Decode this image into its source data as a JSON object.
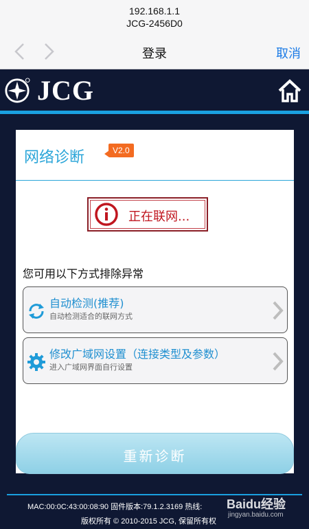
{
  "browser": {
    "url": "192.168.1.1",
    "page_title": "JCG-2456D0",
    "nav_title": "登录",
    "cancel_label": "取消"
  },
  "brand": {
    "name": "JCG"
  },
  "panel": {
    "title": "网络诊断",
    "version": "V2.0",
    "status_text": "正在联网...",
    "hint": "您可用以下方式排除异常",
    "options": [
      {
        "title": "自动检测(推荐)",
        "subtitle": "自动检测适合的联网方式",
        "icon": "refresh-icon"
      },
      {
        "title": "修改广域网设置（连接类型及参数）",
        "subtitle": "进入广域网界面自行设置",
        "icon": "gear-icon"
      }
    ],
    "retry_label": "重新诊断"
  },
  "footer": {
    "line1": "MAC:00:0C:43:00:08:90   固件版本:79.1.2.3169   热线:",
    "line2": "版权所有 © 2010-2015 JCG, 保留所有权"
  },
  "watermark": {
    "logo": "Baidu经验",
    "sub": "jingyan.baidu.com"
  },
  "colors": {
    "header_bg": "#0f1833",
    "accent_blue": "#2aa5d8",
    "status_red": "#c0161f",
    "badge_orange": "#f36b21",
    "link_blue": "#1a7ae6"
  }
}
